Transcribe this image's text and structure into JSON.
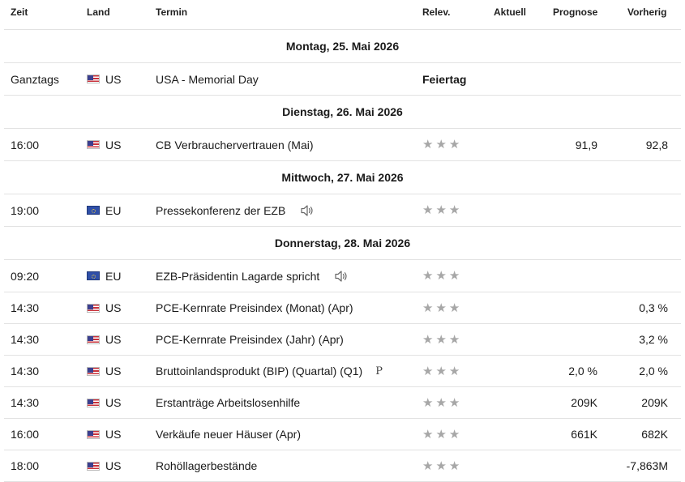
{
  "columns": {
    "time": "Zeit",
    "country": "Land",
    "event": "Termin",
    "relevance": "Relev.",
    "actual": "Aktuell",
    "forecast": "Prognose",
    "previous": "Vorherig"
  },
  "dates": {
    "d1": "Montag, 25. Mai 2026",
    "d2": "Dienstag, 26. Mai 2026",
    "d3": "Mittwoch, 27. Mai 2026",
    "d4": "Donnerstag, 28. Mai 2026"
  },
  "rows": [
    {
      "time": "Ganztags",
      "country": "US",
      "event": "USA - Memorial Day",
      "relevance_text": "Feiertag",
      "actual": "",
      "forecast": "",
      "previous": ""
    },
    {
      "time": "16:00",
      "country": "US",
      "event": "CB Verbrauchervertrauen  (Mai)",
      "actual": "",
      "forecast": "91,9",
      "previous": "92,8"
    },
    {
      "time": "19:00",
      "country": "EU",
      "event": "Pressekonferenz der EZB",
      "actual": "",
      "forecast": "",
      "previous": ""
    },
    {
      "time": "09:20",
      "country": "EU",
      "event": "EZB-Präsidentin Lagarde spricht",
      "actual": "",
      "forecast": "",
      "previous": ""
    },
    {
      "time": "14:30",
      "country": "US",
      "event": "PCE-Kernrate Preisindex (Monat) (Apr)",
      "actual": "",
      "forecast": "",
      "previous": "0,3 %"
    },
    {
      "time": "14:30",
      "country": "US",
      "event": "PCE-Kernrate Preisindex (Jahr) (Apr)",
      "actual": "",
      "forecast": "",
      "previous": "3,2 %"
    },
    {
      "time": "14:30",
      "country": "US",
      "event": "Bruttoinlandsprodukt (BIP) (Quartal) (Q1)",
      "badge": "P",
      "actual": "",
      "forecast": "2,0 %",
      "previous": "2,0 %"
    },
    {
      "time": "14:30",
      "country": "US",
      "event": "Erstanträge Arbeitslosenhilfe",
      "actual": "",
      "forecast": "209K",
      "previous": "209K"
    },
    {
      "time": "16:00",
      "country": "US",
      "event": "Verkäufe neuer Häuser  (Apr)",
      "actual": "",
      "forecast": "661K",
      "previous": "682K"
    },
    {
      "time": "18:00",
      "country": "US",
      "event": "Rohöllagerbestände",
      "actual": "",
      "forecast": "",
      "previous": "-7,863M"
    }
  ],
  "icons": {
    "star": "star-icon",
    "speaker": "speaker-icon",
    "flag_us": "us-flag-icon",
    "flag_eu": "eu-flag-icon"
  },
  "colors": {
    "star": "#a7a7a7",
    "border": "#e2e2e2"
  }
}
